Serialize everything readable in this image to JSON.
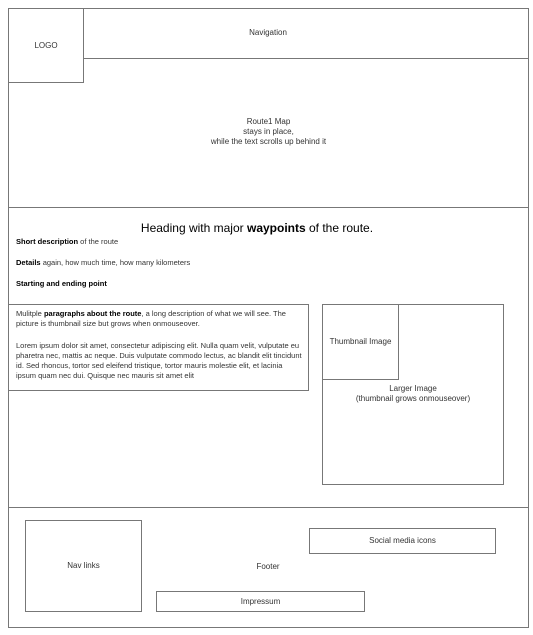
{
  "header": {
    "logo_label": "LOGO",
    "nav_label": "Navigation",
    "map_lines": [
      "Route1 Map",
      "stays in place,",
      "while the text scrolls up behind it"
    ]
  },
  "content": {
    "heading_pre": "Heading with major ",
    "heading_bold": "waypoints",
    "heading_post": " of the route.",
    "short_desc_bold": "Short description",
    "short_desc_rest": " of the route",
    "details_bold": "Details",
    "details_rest": " again, how much time, how many kilometers",
    "start_end_bold": "Starting and ending point",
    "para1_pre": "Mulitple ",
    "para1_bold": "paragraphs about the route",
    "para1_rest": ", a long description of what we will see. The picture is thumbnail size but grows when onmouseover.",
    "para2": "Lorem ipsum dolor sit amet, consectetur adipiscing elit. Nulla quam velit, vulputate eu pharetra nec, mattis ac neque. Duis vulputate commodo lectus, ac blandit elit tincidunt id. Sed rhoncus, tortor sed eleifend tristique, tortor mauris molestie elit, et lacinia ipsum quam nec dui. Quisque nec mauris sit amet elit",
    "thumbnail_label": "Thumbnail Image",
    "larger_label": "Larger Image",
    "larger_sub": "(thumbnail grows onmouseover)"
  },
  "footer": {
    "nav_links_label": "Nav links",
    "footer_label": "Footer",
    "social_label": "Social media icons",
    "impressum_label": "Impressum"
  },
  "colors": {
    "border": "#777777",
    "background": "#ffffff",
    "page_bg": "#f0f0f0"
  }
}
